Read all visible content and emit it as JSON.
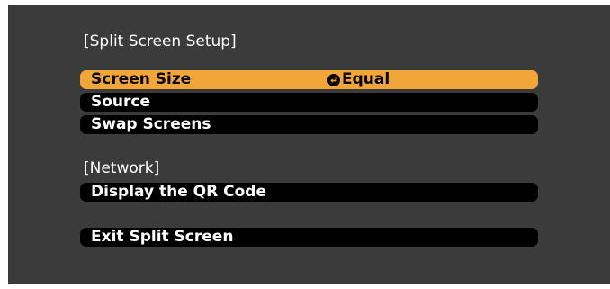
{
  "osd": {
    "split_screen_setup_title": "[Split Screen Setup]",
    "network_title": "[Network]",
    "items": [
      {
        "label": "Screen Size",
        "value": "Equal",
        "icon": "return-icon",
        "selected": true
      },
      {
        "label": "Source",
        "value": "",
        "selected": false
      },
      {
        "label": "Swap Screens",
        "value": "",
        "selected": false
      },
      {
        "label": "Display the QR Code",
        "value": "",
        "selected": false
      },
      {
        "label": "Exit Split Screen",
        "value": "",
        "selected": false
      }
    ]
  },
  "colors": {
    "osd_background": "#3b3b3b",
    "item_background": "#000000",
    "selected_background": "#f2a538",
    "text": "#ffffff",
    "selected_text": "#000000"
  }
}
